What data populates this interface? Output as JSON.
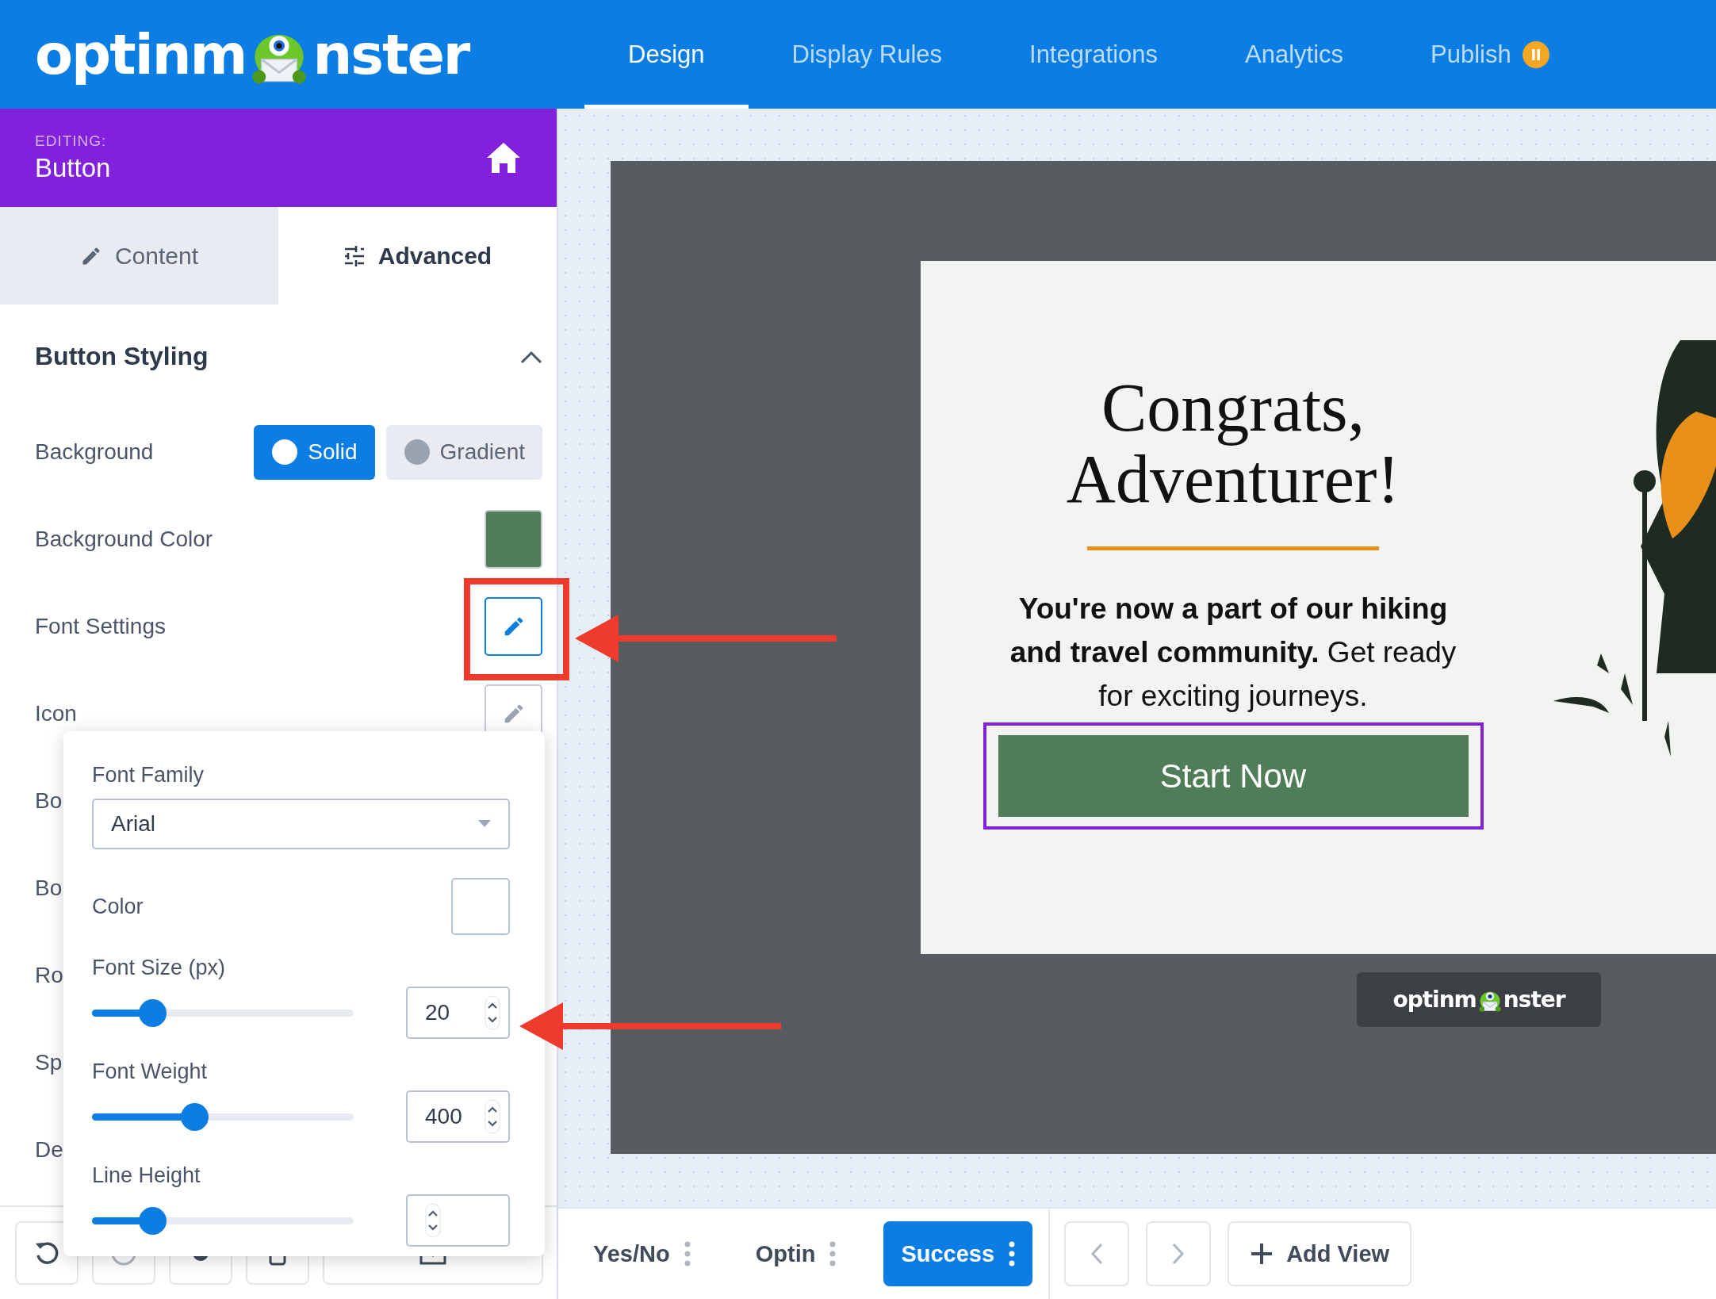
{
  "header": {
    "logo": [
      "optinm",
      "nster"
    ],
    "nav": [
      {
        "label": "Design",
        "selected": true,
        "kind": "text"
      },
      {
        "label": "Display Rules",
        "selected": false,
        "kind": "text"
      },
      {
        "label": "Integrations",
        "selected": false,
        "kind": "text"
      },
      {
        "label": "Analytics",
        "selected": false,
        "kind": "text"
      },
      {
        "label": "Publish",
        "selected": false,
        "kind": "badge"
      }
    ]
  },
  "editor": {
    "caption": "EDITING:",
    "title": "Button"
  },
  "tabs": [
    {
      "label": "Content",
      "selected": false
    },
    {
      "label": "Advanced",
      "selected": true
    }
  ],
  "section": {
    "title": "Button Styling",
    "expanded": true
  },
  "rows": [
    {
      "kind": "toggle",
      "label": "Background",
      "options": [
        {
          "label": "Solid",
          "selected": true
        },
        {
          "label": "Gradient",
          "selected": false
        }
      ]
    },
    {
      "kind": "swatch",
      "label": "Background Color",
      "color": "#4e7d57"
    },
    {
      "kind": "edit",
      "label": "Font Settings",
      "selected": true
    },
    {
      "kind": "edit",
      "label": "Icon",
      "selected": false
    },
    {
      "kind": "plain",
      "label": "Bo"
    },
    {
      "kind": "plain",
      "label": "Bo"
    },
    {
      "kind": "plain",
      "label": "Ro"
    },
    {
      "kind": "plain",
      "label": "Sp"
    },
    {
      "kind": "plain",
      "label": "De"
    }
  ],
  "popup": {
    "font_family": {
      "label": "Font Family",
      "value": "Arial"
    },
    "color": {
      "label": "Color",
      "color": "#ffffff"
    },
    "sliders": [
      {
        "label": "Font Size (px)",
        "level": 0.23,
        "value": "20"
      },
      {
        "label": "Font Weight",
        "level": 0.39,
        "value": "400"
      },
      {
        "label": "Line Height",
        "level": 0.23
      }
    ]
  },
  "canvas": {
    "heading": "Congrats, Adventurer!",
    "message": "**You're now a part of our hiking and travel community.** Get ready for exciting journeys.",
    "button": {
      "label": "Start Now",
      "selected": true
    },
    "branding": [
      "optinm",
      "nster"
    ]
  },
  "views": [
    {
      "label": "Yes/No",
      "selected": false
    },
    {
      "label": "Optin",
      "selected": false
    },
    {
      "label": "Success",
      "selected": true
    }
  ],
  "add_view": "Add View"
}
